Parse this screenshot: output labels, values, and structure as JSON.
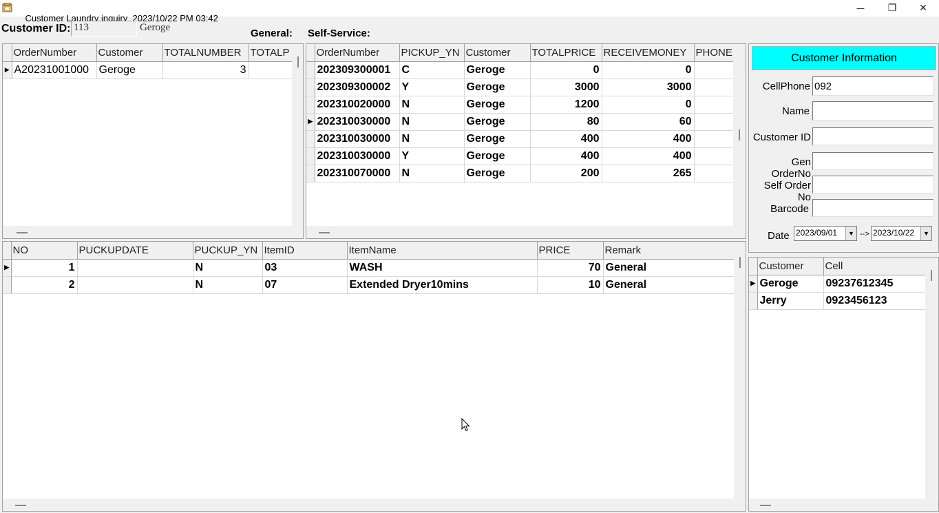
{
  "window": {
    "title": "Customer Laundry inquiry",
    "datetime": "2023/10/22 PM 03:42",
    "minimize_glyph": "—",
    "restore_glyph": "❐",
    "close_glyph": "✕"
  },
  "top": {
    "customer_id_label": "Customer ID:",
    "customer_id_value": "113",
    "customer_name": "Geroge",
    "general_label": "General:",
    "self_service_label": "Self-Service:"
  },
  "general_orders": {
    "columns": [
      "OrderNumber",
      "Customer",
      "TOTALNUMBER",
      "TOTALP"
    ],
    "rows": [
      {
        "order": "A20231001000",
        "customer": "Geroge",
        "total_number": "3",
        "total_p": ""
      }
    ]
  },
  "self_orders": {
    "columns": [
      "OrderNumber",
      "PICKUP_YN",
      "Customer",
      "TOTALPRICE",
      "RECEIVEMONEY",
      "PHONE"
    ],
    "rows": [
      {
        "order": "202309300001",
        "pickup": "C",
        "customer": "Geroge",
        "price": "0",
        "received": "0",
        "phone": ""
      },
      {
        "order": "202309300002",
        "pickup": "Y",
        "customer": "Geroge",
        "price": "3000",
        "received": "3000",
        "phone": ""
      },
      {
        "order": "202310020000",
        "pickup": "N",
        "customer": "Geroge",
        "price": "1200",
        "received": "0",
        "phone": ""
      },
      {
        "order": "202310030000",
        "pickup": "N",
        "customer": "Geroge",
        "price": "80",
        "received": "60",
        "phone": ""
      },
      {
        "order": "202310030000",
        "pickup": "N",
        "customer": "Geroge",
        "price": "400",
        "received": "400",
        "phone": ""
      },
      {
        "order": "202310030000",
        "pickup": "Y",
        "customer": "Geroge",
        "price": "400",
        "received": "400",
        "phone": ""
      },
      {
        "order": "202310070000",
        "pickup": "N",
        "customer": "Geroge",
        "price": "200",
        "received": "265",
        "phone": ""
      }
    ]
  },
  "items": {
    "columns": [
      "NO",
      "PUCKUPDATE",
      "PUCKUP_YN",
      "ItemID",
      "ItemName",
      "PRICE",
      "Remark"
    ],
    "rows": [
      {
        "no": "1",
        "date": "",
        "yn": "N",
        "item_id": "03",
        "item_name": "WASH",
        "price": "70",
        "remark": "General"
      },
      {
        "no": "2",
        "date": "",
        "yn": "N",
        "item_id": "07",
        "item_name": "Extended Dryer10mins",
        "price": "10",
        "remark": "General"
      }
    ]
  },
  "info": {
    "header": "Customer Information",
    "cellphone_label": "CellPhone",
    "cellphone_value": "092",
    "name_label": "Name",
    "customer_id_label": "Customer ID",
    "gen_order_label": "Gen OrderNo",
    "self_order_label": "Self Order No",
    "barcode_label": "Barcode",
    "date_label": "Date",
    "date_from": "2023/09/01",
    "date_sep": "-->",
    "date_to": "2023/10/22",
    "header_color": "#00ffff"
  },
  "customers": {
    "columns": [
      "Customer",
      "Cell"
    ],
    "rows": [
      {
        "name": "Geroge",
        "cell": "09237612345"
      },
      {
        "name": "Jerry",
        "cell": "0923456123"
      }
    ]
  }
}
